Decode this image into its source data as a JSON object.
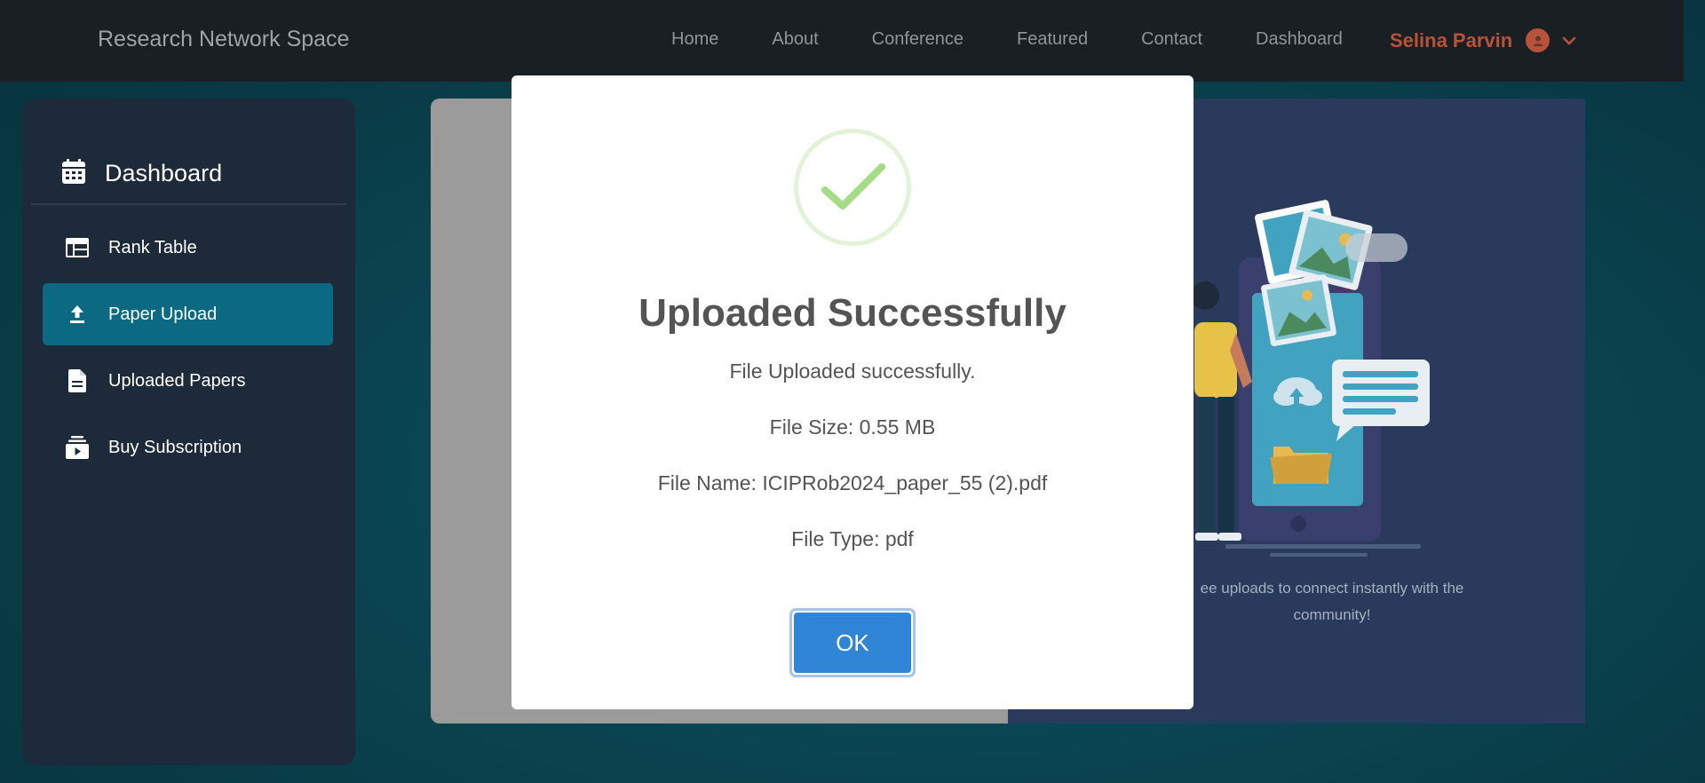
{
  "navbar": {
    "brand": "Research Network Space",
    "links": [
      "Home",
      "About",
      "Conference",
      "Featured",
      "Contact",
      "Dashboard"
    ],
    "user_name": "Selina Parvin",
    "user_icon": "user-avatar-icon",
    "dropdown_icon": "chevron-down-icon"
  },
  "sidebar": {
    "title": "Dashboard",
    "title_icon": "calendar-icon",
    "items": [
      {
        "label": "Rank Table",
        "icon": "table-icon",
        "active": false
      },
      {
        "label": "Paper Upload",
        "icon": "upload-icon",
        "active": true
      },
      {
        "label": "Uploaded Papers",
        "icon": "document-icon",
        "active": false
      },
      {
        "label": "Buy Subscription",
        "icon": "subscription-icon",
        "active": false
      }
    ]
  },
  "main": {
    "caption": "ee uploads to connect instantly with the community!"
  },
  "modal": {
    "icon": "success-check-icon",
    "title": "Uploaded Successfully",
    "message": "File Uploaded successfully.",
    "file_size": "File Size: 0.55 MB",
    "file_name": "File Name: ICIPRob2024_paper_55 (2).pdf",
    "file_type": "File Type: pdf",
    "ok_label": "OK"
  },
  "colors": {
    "navbar_bg": "#1a1f24",
    "sidebar_bg": "#1c2a3a",
    "sidebar_active": "#0b6a82",
    "user_accent": "#b8533a",
    "ok_button": "#3085d6",
    "success_check": "#a5dc86"
  }
}
